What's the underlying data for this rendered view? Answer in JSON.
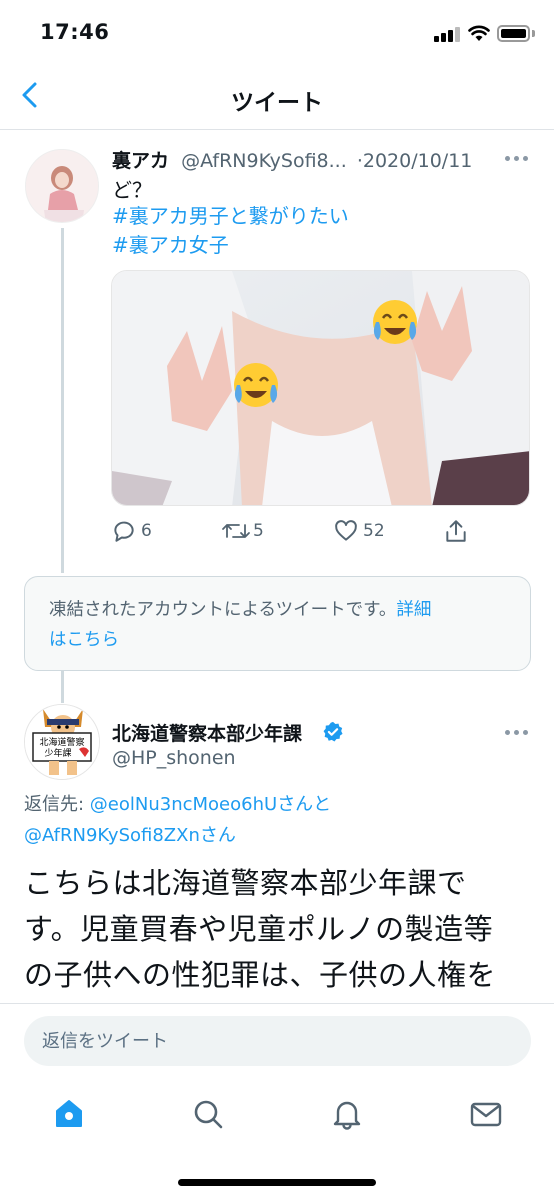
{
  "status_bar": {
    "time": "17:46"
  },
  "nav": {
    "title": "ツイート"
  },
  "tweet1": {
    "display_name": "裏アカ",
    "handle": "@AfRN9KySofi8...",
    "separator": "·",
    "date": "2020/10/11",
    "text": "ど？",
    "hashtags": [
      "#裏アカ男子と繋がりたい",
      "#裏アカ女子"
    ],
    "replies": "6",
    "retweets": "5",
    "likes": "52"
  },
  "notice": {
    "text": "凍結されたアカウントによるツイートです。",
    "link_part1": "詳細",
    "link_part2": "はこちら"
  },
  "tweet2": {
    "display_name": "北海道警察本部少年課",
    "handle": "@HP_shonen",
    "reply_label": "返信先: ",
    "reply_mention1": "@eolNu3ncMoeo6hU",
    "reply_and": "さんと",
    "reply_mention2": "@AfRN9KySofi8ZXn",
    "reply_san": "さん",
    "body_lines": [
      "こちらは北海道警察本部少年課で",
      "す。児童買春や児童ポルノの製造等",
      "の子供への性犯罪は、子供の人権を"
    ],
    "avatar_sign": [
      "北海道警察",
      "少年課"
    ]
  },
  "reply_bar": {
    "placeholder": "返信をツイート"
  },
  "tabs": [
    "home-icon",
    "search-icon",
    "notifications-icon",
    "messages-icon"
  ],
  "colors": {
    "accent": "#1d9bf0",
    "secondary_text": "#536471"
  }
}
